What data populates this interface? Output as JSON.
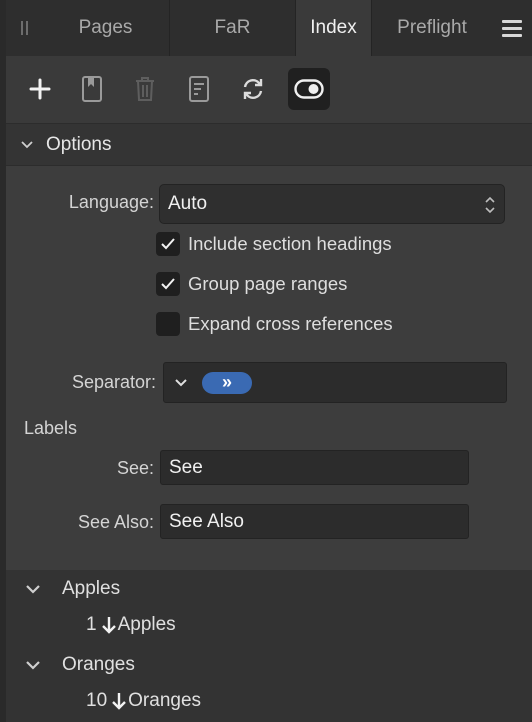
{
  "tabs": [
    {
      "label": "Pages",
      "active": false
    },
    {
      "label": "FaR",
      "active": false
    },
    {
      "label": "Index",
      "active": true
    },
    {
      "label": "Preflight",
      "active": false
    }
  ],
  "toolbar": {
    "icons": [
      "plus-icon",
      "bookmark-icon",
      "trash-icon",
      "document-icon",
      "refresh-icon",
      "toggle-icon"
    ]
  },
  "options": {
    "header": "Options",
    "language_label": "Language:",
    "language_value": "Auto",
    "checkboxes": [
      {
        "label": "Include section headings",
        "checked": true
      },
      {
        "label": "Group page ranges",
        "checked": true
      },
      {
        "label": "Expand cross references",
        "checked": false
      }
    ],
    "separator_label": "Separator:",
    "separator_token": "»",
    "labels_title": "Labels",
    "see_label": "See:",
    "see_value": "See",
    "see_also_label": "See Also:",
    "see_also_value": "See Also"
  },
  "index": [
    {
      "group": "Apples",
      "entry_page": "1",
      "entry_text": "Apples"
    },
    {
      "group": "Oranges",
      "entry_page": "10",
      "entry_text": "Oranges"
    }
  ],
  "colors": {
    "accent_token": "#3a6ab3",
    "active_tab_bg": "#3a3a3a",
    "panel_bg": "#3d3d3d"
  }
}
